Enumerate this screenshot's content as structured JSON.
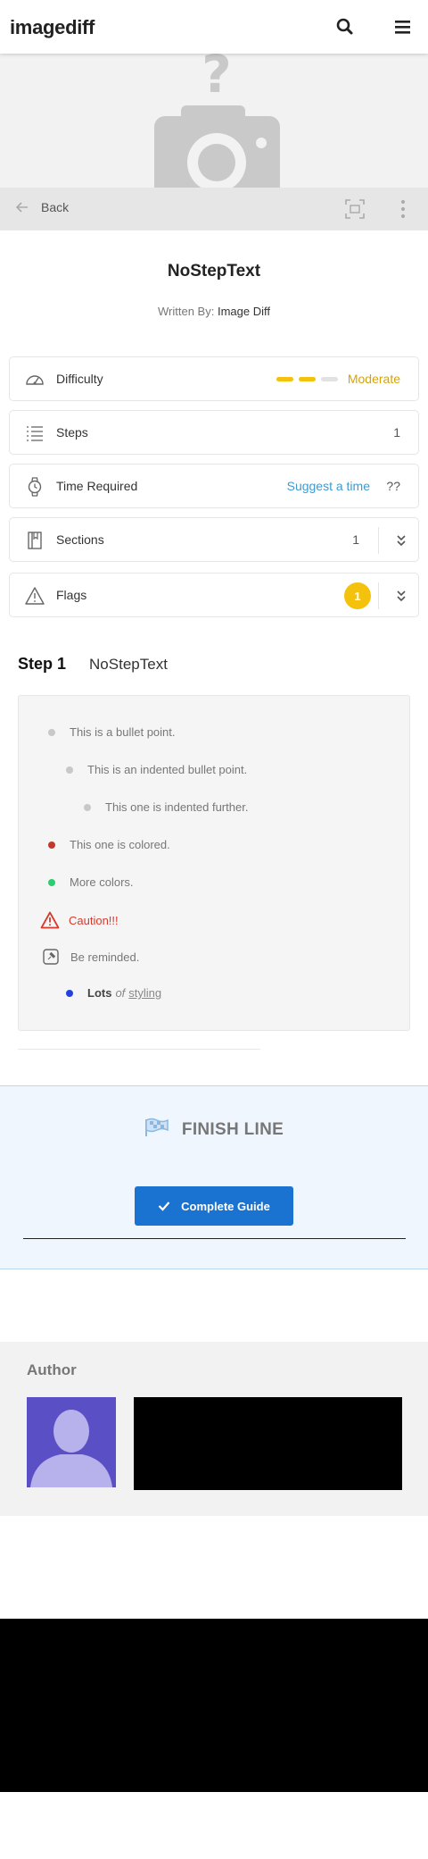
{
  "header": {
    "brand": "imagediff",
    "search_icon": "search-icon",
    "menu_icon": "hamburger-menu-icon"
  },
  "hero": {
    "image_icon": "camera-question-icon"
  },
  "toolbar": {
    "back_label": "Back",
    "fullscreen_icon": "fullscreen-icon",
    "more_icon": "more-vertical-icon"
  },
  "guide": {
    "title": "NoStepText",
    "written_by_label": "Written By:",
    "author": "Image Diff"
  },
  "stats": {
    "difficulty": {
      "label": "Difficulty",
      "value": "Moderate",
      "level_filled": 2,
      "level_total": 3
    },
    "steps": {
      "label": "Steps",
      "value": "1"
    },
    "time": {
      "label": "Time Required",
      "suggest": "Suggest a time",
      "value": "??"
    },
    "sections": {
      "label": "Sections",
      "value": "1"
    },
    "flags": {
      "label": "Flags",
      "value": "1"
    }
  },
  "step": {
    "number_label": "Step 1",
    "title": "NoStepText",
    "lines": [
      {
        "text": "This is a bullet point."
      },
      {
        "text": "This is an indented bullet point."
      },
      {
        "text": "This one is indented further."
      },
      {
        "text": "This one is colored."
      },
      {
        "text": "More colors."
      },
      {
        "text": "Caution!!!"
      },
      {
        "text": "Be reminded."
      }
    ],
    "styled_line": {
      "bold": "Lots",
      "italic": "of",
      "underline": "styling"
    }
  },
  "finish": {
    "title": "FINISH LINE",
    "button_label": "Complete Guide"
  },
  "author_section": {
    "heading": "Author"
  },
  "colors": {
    "accent_blue": "#1a73d1",
    "difficulty_yellow": "#f4c20d",
    "caution_red": "#d63a2c",
    "green_dot": "#2ecc71",
    "blue_dot": "#2441e0",
    "red_dot": "#c0392b"
  }
}
